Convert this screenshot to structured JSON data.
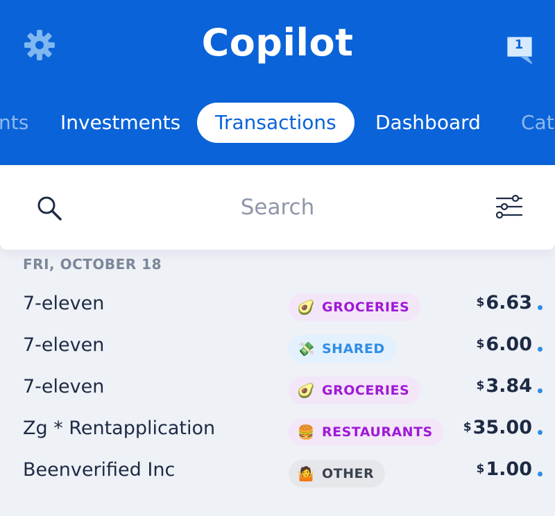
{
  "app": {
    "title": "Copilot",
    "notification_count": "1"
  },
  "tabs": [
    {
      "label": "nts",
      "state": "faded"
    },
    {
      "label": "Investments",
      "state": "normal"
    },
    {
      "label": "Transactions",
      "state": "active"
    },
    {
      "label": "Dashboard",
      "state": "normal"
    },
    {
      "label": "Cat",
      "state": "faded"
    }
  ],
  "search": {
    "placeholder": "Search",
    "value": ""
  },
  "icons": {
    "settings": "gear-icon",
    "messages": "chat-bubble-icon",
    "search": "magnifier-icon",
    "filter": "sliders-icon"
  },
  "colors": {
    "brand": "#0a63d8",
    "unread_dot": "#2f8de4",
    "groceries_bg": "#f3e6f8",
    "groceries_fg": "#a018d8",
    "shared_bg": "#e3f0fd",
    "shared_fg": "#2f8de4",
    "restaurants_bg": "#f3e6f8",
    "restaurants_fg": "#a018d8",
    "other_bg": "#e6e7ea",
    "other_fg": "#3a4150"
  },
  "date_group": "FRI, OCTOBER 18",
  "transactions": [
    {
      "merchant": "7-eleven",
      "category": "GROCERIES",
      "emoji": "🥑",
      "currency": "$",
      "amount": "6.63"
    },
    {
      "merchant": "7-eleven",
      "category": "SHARED",
      "emoji": "💸",
      "currency": "$",
      "amount": "6.00"
    },
    {
      "merchant": "7-eleven",
      "category": "GROCERIES",
      "emoji": "🥑",
      "currency": "$",
      "amount": "3.84"
    },
    {
      "merchant": "Zg * Rentapplication",
      "category": "RESTAURANTS",
      "emoji": "🍔",
      "currency": "$",
      "amount": "35.00"
    },
    {
      "merchant": "Beenverified Inc",
      "category": "OTHER",
      "emoji": "🤷",
      "currency": "$",
      "amount": "1.00"
    }
  ]
}
